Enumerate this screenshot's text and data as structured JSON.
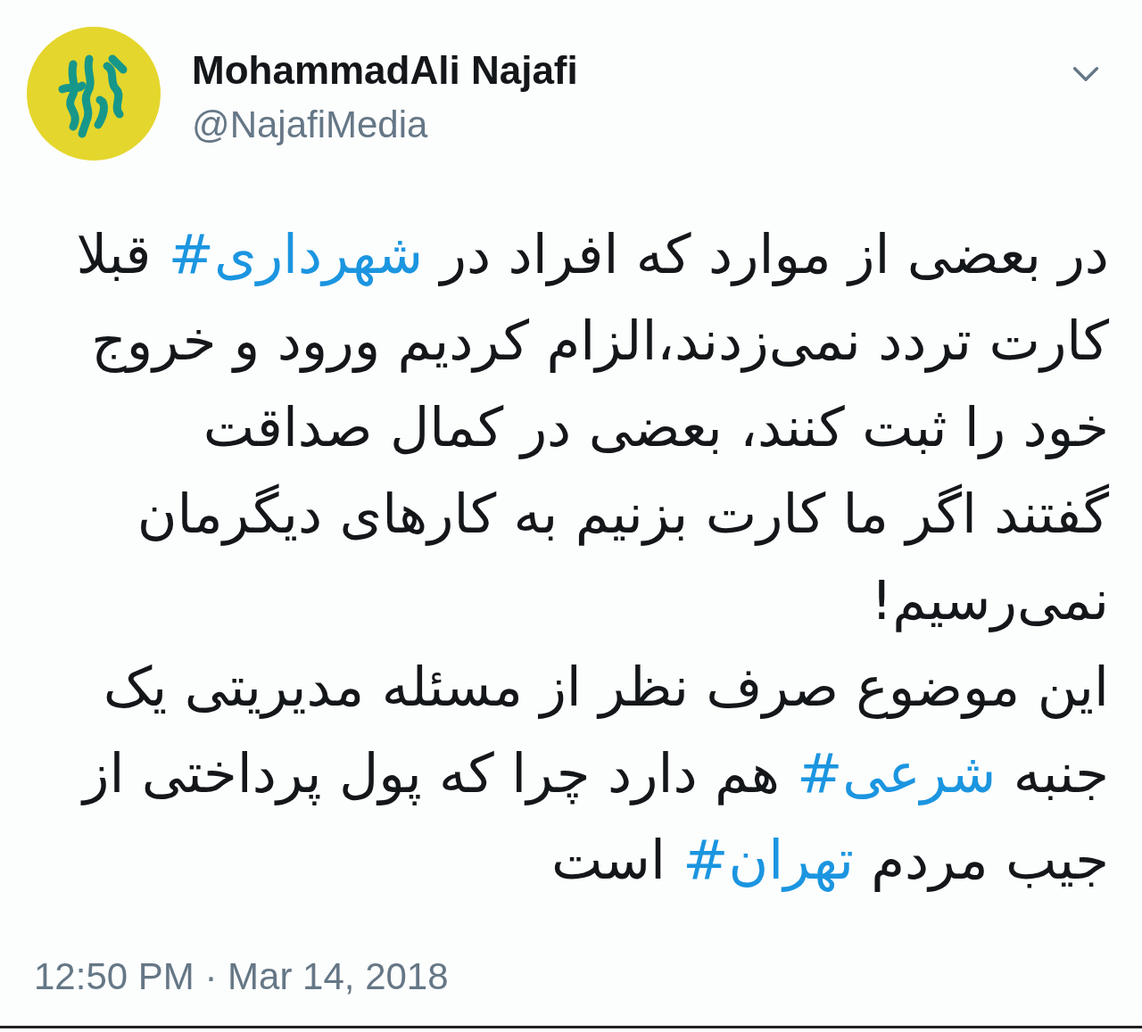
{
  "tweet": {
    "author": {
      "name": "MohammadAli Najafi",
      "handle": "@NajafiMedia"
    },
    "body": [
      [
        {
          "kind": "text",
          "text": "در بعضی از موارد که افراد در "
        },
        {
          "kind": "hashtag",
          "text": "#شهرداری"
        },
        {
          "kind": "text",
          "text": " قبلا"
        }
      ],
      [
        {
          "kind": "text",
          "text": "کارت تردد نمی‌زدند،الزام کردیم ورود و خروج"
        }
      ],
      [
        {
          "kind": "text",
          "text": "خود را ثبت کنند، بعضی در کمال صداقت"
        }
      ],
      [
        {
          "kind": "text",
          "text": "گفتند اگر ما کارت بزنیم به کارهای دیگرمان"
        }
      ],
      [
        {
          "kind": "text",
          "text": "نمی‌رسیم!"
        }
      ],
      [
        {
          "kind": "text",
          "text": "این موضوع صرف نظر از مسئله مدیریتی یک"
        }
      ],
      [
        {
          "kind": "text",
          "text": "جنبه "
        },
        {
          "kind": "hashtag",
          "text": "#شرعی"
        },
        {
          "kind": "text",
          "text": " هم دارد چرا که پول پرداختی از"
        }
      ],
      [
        {
          "kind": "text",
          "text": "جیب مردم "
        },
        {
          "kind": "hashtag",
          "text": "#تهران"
        },
        {
          "kind": "text",
          "text": " است"
        }
      ]
    ],
    "timestamp": "12:50 PM · Mar 14, 2018"
  }
}
